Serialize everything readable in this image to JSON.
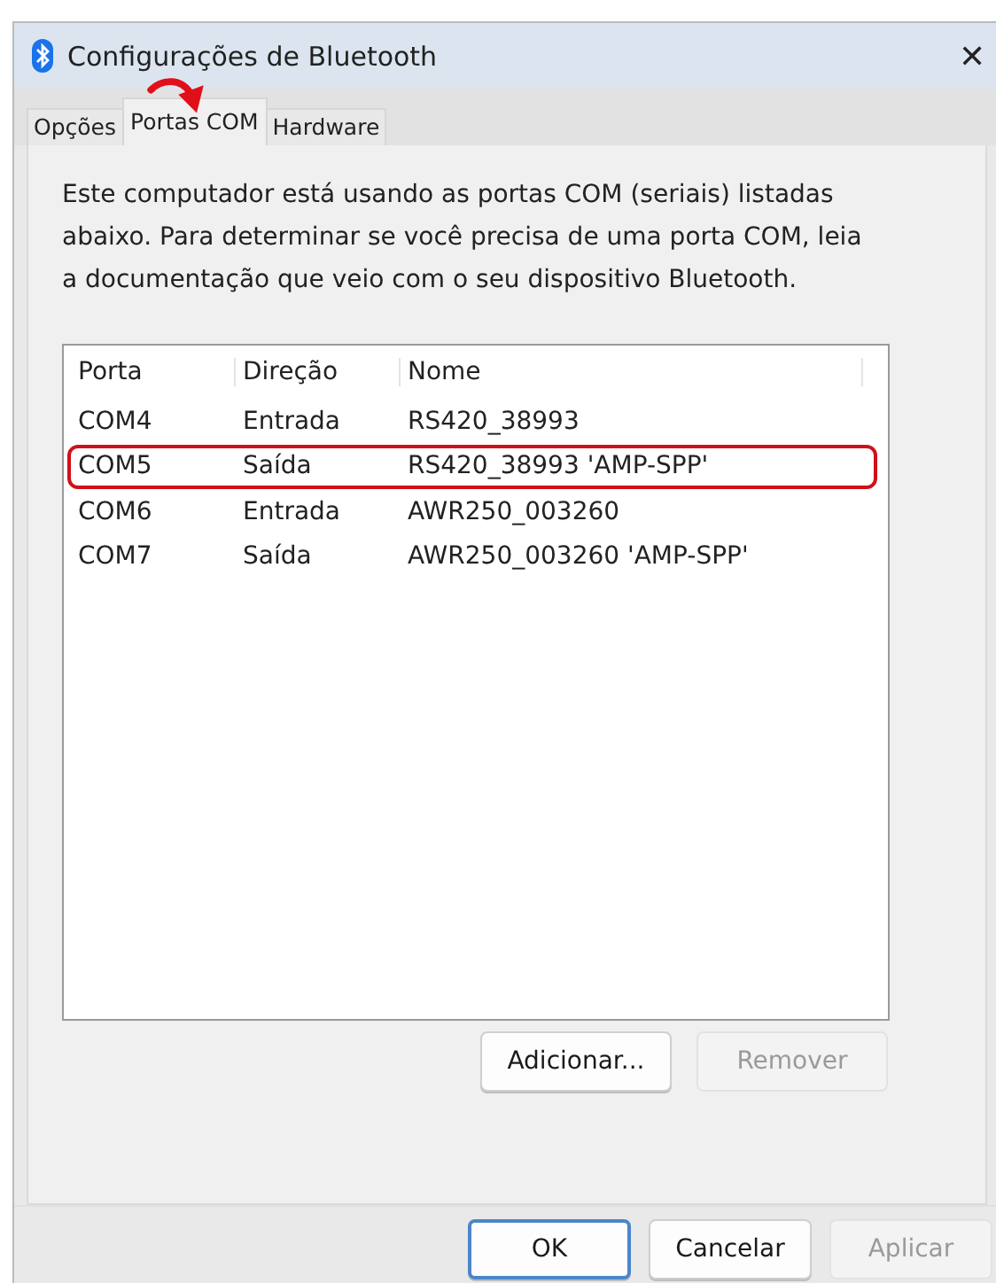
{
  "window": {
    "title": "Configurações de Bluetooth",
    "close": "✕"
  },
  "tabs": [
    {
      "label": "Opções",
      "selected": false,
      "pointed": false
    },
    {
      "label": "Portas COM",
      "selected": true,
      "pointed": true
    },
    {
      "label": "Hardware",
      "selected": false,
      "pointed": false
    }
  ],
  "description": "Este computador está usando as portas COM (seriais) listadas abaixo. Para determinar se você precisa de uma porta COM, leia a documentação que veio com o seu dispositivo Bluetooth.",
  "table": {
    "columns": [
      "Porta",
      "Direção",
      "Nome"
    ],
    "rows": [
      {
        "cells": [
          "COM4",
          "Entrada",
          "RS420_38993"
        ],
        "highlighted": false
      },
      {
        "cells": [
          "COM5",
          "Saída",
          "RS420_38993 'AMP-SPP'"
        ],
        "highlighted": true
      },
      {
        "cells": [
          "COM6",
          "Entrada",
          "AWR250_003260"
        ],
        "highlighted": false
      },
      {
        "cells": [
          "COM7",
          "Saída",
          "AWR250_003260 'AMP-SPP'"
        ],
        "highlighted": false
      }
    ]
  },
  "list_buttons": [
    {
      "label": "Adicionar...",
      "disabled": false
    },
    {
      "label": "Remover",
      "disabled": true
    }
  ],
  "dialog_buttons": [
    {
      "label": "OK",
      "disabled": false,
      "default": true
    },
    {
      "label": "Cancelar",
      "disabled": false,
      "default": false
    },
    {
      "label": "Aplicar",
      "disabled": true,
      "default": false
    }
  ]
}
